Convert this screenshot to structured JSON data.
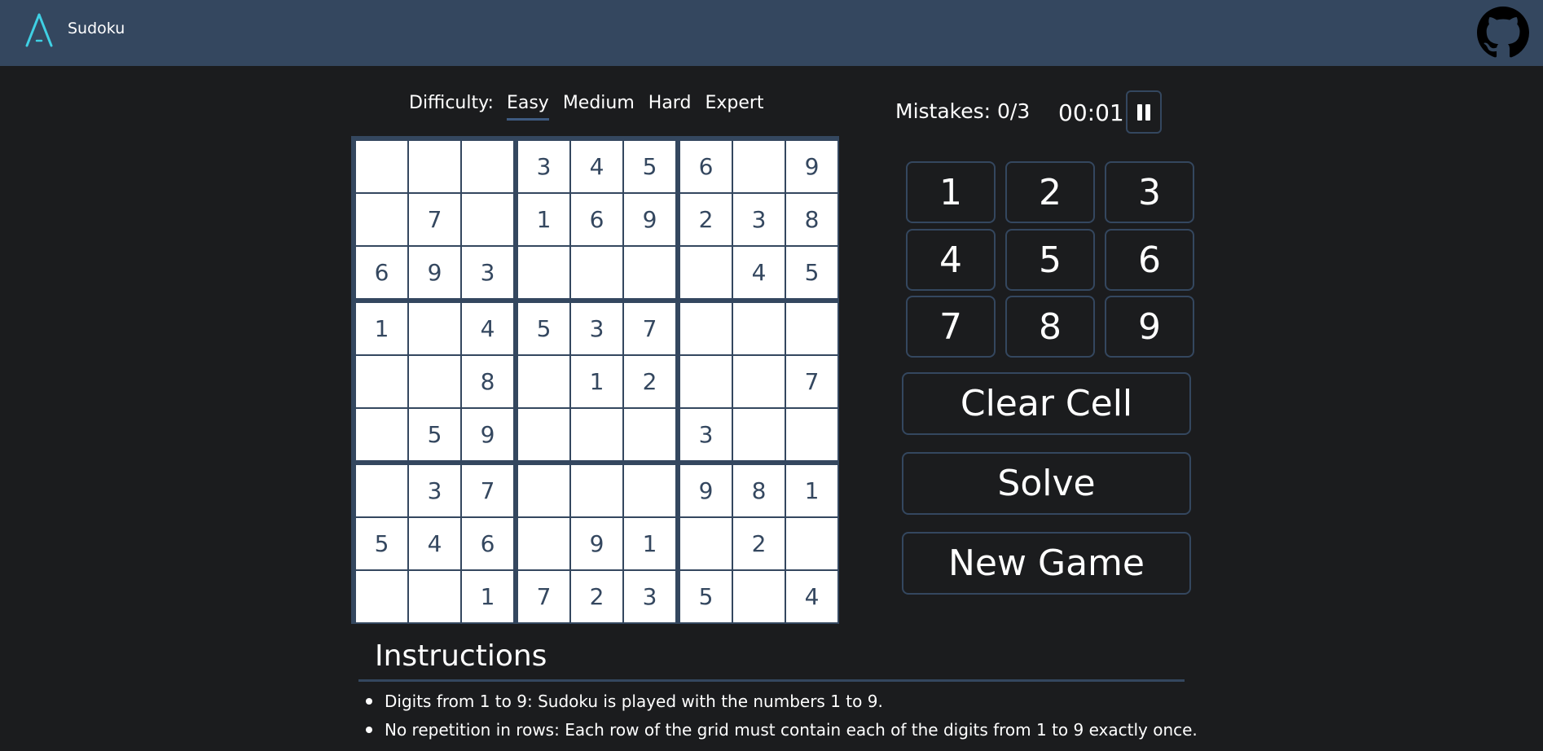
{
  "header": {
    "title": "Sudoku"
  },
  "difficulty": {
    "label": "Difficulty:",
    "options": [
      "Easy",
      "Medium",
      "Hard",
      "Expert"
    ],
    "selected": "Easy"
  },
  "board": [
    [
      "",
      "",
      "",
      "3",
      "4",
      "5",
      "6",
      "",
      "9"
    ],
    [
      "",
      "7",
      "",
      "1",
      "6",
      "9",
      "2",
      "3",
      "8"
    ],
    [
      "6",
      "9",
      "3",
      "",
      "",
      "",
      "",
      "4",
      "5"
    ],
    [
      "1",
      "",
      "4",
      "5",
      "3",
      "7",
      "",
      "",
      ""
    ],
    [
      "",
      "",
      "8",
      "",
      "1",
      "2",
      "",
      "",
      "7"
    ],
    [
      "",
      "5",
      "9",
      "",
      "",
      "",
      "3",
      "",
      ""
    ],
    [
      "",
      "3",
      "7",
      "",
      "",
      "",
      "9",
      "8",
      "1"
    ],
    [
      "5",
      "4",
      "6",
      "",
      "9",
      "1",
      "",
      "2",
      ""
    ],
    [
      "",
      "",
      "1",
      "7",
      "2",
      "3",
      "5",
      "",
      "4"
    ]
  ],
  "status": {
    "mistakes": "Mistakes: 0/3",
    "timer": "00:01"
  },
  "numpad": [
    "1",
    "2",
    "3",
    "4",
    "5",
    "6",
    "7",
    "8",
    "9"
  ],
  "actions": {
    "clear": "Clear Cell",
    "solve": "Solve",
    "new_game": "New Game"
  },
  "instructions": {
    "title": "Instructions",
    "items": [
      "Digits from 1 to 9: Sudoku is played with the numbers 1 to 9.",
      "No repetition in rows: Each row of the grid must contain each of the digits from 1 to 9 exactly once."
    ]
  },
  "colors": {
    "header_bg": "#34475f",
    "page_bg": "#1b1c1e",
    "accent": "#3fd0e4",
    "cell_text": "#34475f"
  },
  "icons": {
    "logo": "app-logo-icon",
    "github": "github-icon",
    "pause": "pause-icon"
  }
}
